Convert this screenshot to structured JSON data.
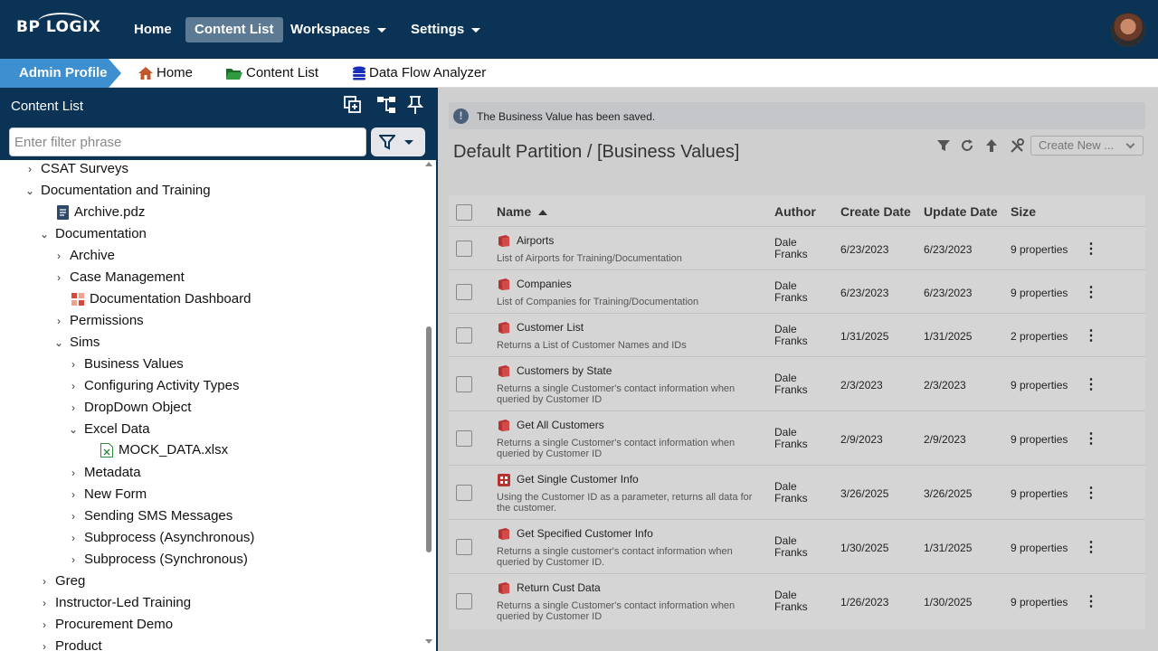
{
  "topnav": {
    "logo": "BP LOGIX",
    "items": [
      {
        "label": "Home"
      },
      {
        "label": "Content List"
      },
      {
        "label": "Workspaces"
      },
      {
        "label": "Settings"
      }
    ]
  },
  "breadcrumb": {
    "admin": "Admin Profile",
    "items": [
      {
        "label": "Home"
      },
      {
        "label": "Content List"
      },
      {
        "label": "Data Flow Analyzer"
      }
    ]
  },
  "leftpanel": {
    "title": "Content List",
    "filter_placeholder": "Enter filter phrase",
    "tree": [
      {
        "label": "CSAT Surveys",
        "chev": "›"
      },
      {
        "label": "Documentation and Training",
        "chev": "⌄"
      },
      {
        "label": "Archive.pdz",
        "chev": ""
      },
      {
        "label": "Documentation",
        "chev": "⌄"
      },
      {
        "label": "Archive",
        "chev": "›"
      },
      {
        "label": "Case Management",
        "chev": "›"
      },
      {
        "label": "Documentation Dashboard",
        "chev": ""
      },
      {
        "label": "Permissions",
        "chev": "›"
      },
      {
        "label": "Sims",
        "chev": "⌄"
      },
      {
        "label": "Business Values",
        "chev": "›"
      },
      {
        "label": "Configuring Activity Types",
        "chev": "›"
      },
      {
        "label": "DropDown Object",
        "chev": "›"
      },
      {
        "label": "Excel Data",
        "chev": "⌄"
      },
      {
        "label": "MOCK_DATA.xlsx",
        "chev": ""
      },
      {
        "label": "Metadata",
        "chev": "›"
      },
      {
        "label": "New Form",
        "chev": "›"
      },
      {
        "label": "Sending SMS Messages",
        "chev": "›"
      },
      {
        "label": "Subprocess (Asynchronous)",
        "chev": "›"
      },
      {
        "label": "Subprocess (Synchronous)",
        "chev": "›"
      },
      {
        "label": "Greg",
        "chev": "›"
      },
      {
        "label": "Instructor-Led Training",
        "chev": "›"
      },
      {
        "label": "Procurement Demo",
        "chev": "›"
      },
      {
        "label": "Product",
        "chev": "›"
      }
    ]
  },
  "main": {
    "alert": "The Business Value has been saved.",
    "title": "Default Partition / [Business Values]",
    "create_new": "Create New ...",
    "columns": {
      "name": "Name",
      "author": "Author",
      "create": "Create Date",
      "update": "Update Date",
      "size": "Size"
    },
    "rows": [
      {
        "name": "Airports",
        "desc": "List of Airports for Training/Documentation",
        "author": "Dale Franks",
        "create": "6/23/2023",
        "update": "6/23/2023",
        "size": "9 properties",
        "more": "⋮"
      },
      {
        "name": "Companies",
        "desc": "List of Companies for Training/Documentation",
        "author": "Dale Franks",
        "create": "6/23/2023",
        "update": "6/23/2023",
        "size": "9 properties",
        "more": "⋮"
      },
      {
        "name": "Customer List",
        "desc": "Returns a List of Customer Names and IDs",
        "author": "Dale Franks",
        "create": "1/31/2025",
        "update": "1/31/2025",
        "size": "2 properties",
        "more": "⋮"
      },
      {
        "name": "Customers by State",
        "desc": "Returns a single Customer's contact information when queried by Customer ID",
        "author": "Dale Franks",
        "create": "2/3/2023",
        "update": "2/3/2023",
        "size": "9 properties",
        "more": "⋮"
      },
      {
        "name": "Get All Customers",
        "desc": "Returns a single Customer's contact information when queried by Customer ID",
        "author": "Dale Franks",
        "create": "2/9/2023",
        "update": "2/9/2023",
        "size": "9 properties",
        "more": "⋮"
      },
      {
        "name": "Get Single Customer Info",
        "desc": "Using the Customer ID as a parameter, returns all data for the customer.",
        "author": "Dale Franks",
        "create": "3/26/2025",
        "update": "3/26/2025",
        "size": "9 properties",
        "more": "⋮"
      },
      {
        "name": "Get Specified Customer Info",
        "desc": "Returns a single customer's contact information when queried by Customer ID.",
        "author": "Dale Franks",
        "create": "1/30/2025",
        "update": "1/31/2025",
        "size": "9 properties",
        "more": "⋮"
      },
      {
        "name": "Return Cust Data",
        "desc": "Returns a single Customer's contact information when queried by Customer ID",
        "author": "Dale Franks",
        "create": "1/26/2023",
        "update": "1/30/2025",
        "size": "9 properties",
        "more": "⋮"
      }
    ]
  },
  "colors": {
    "navy": "#0b3355",
    "accent": "#3e8fd0",
    "red_icon": "#b83232"
  }
}
